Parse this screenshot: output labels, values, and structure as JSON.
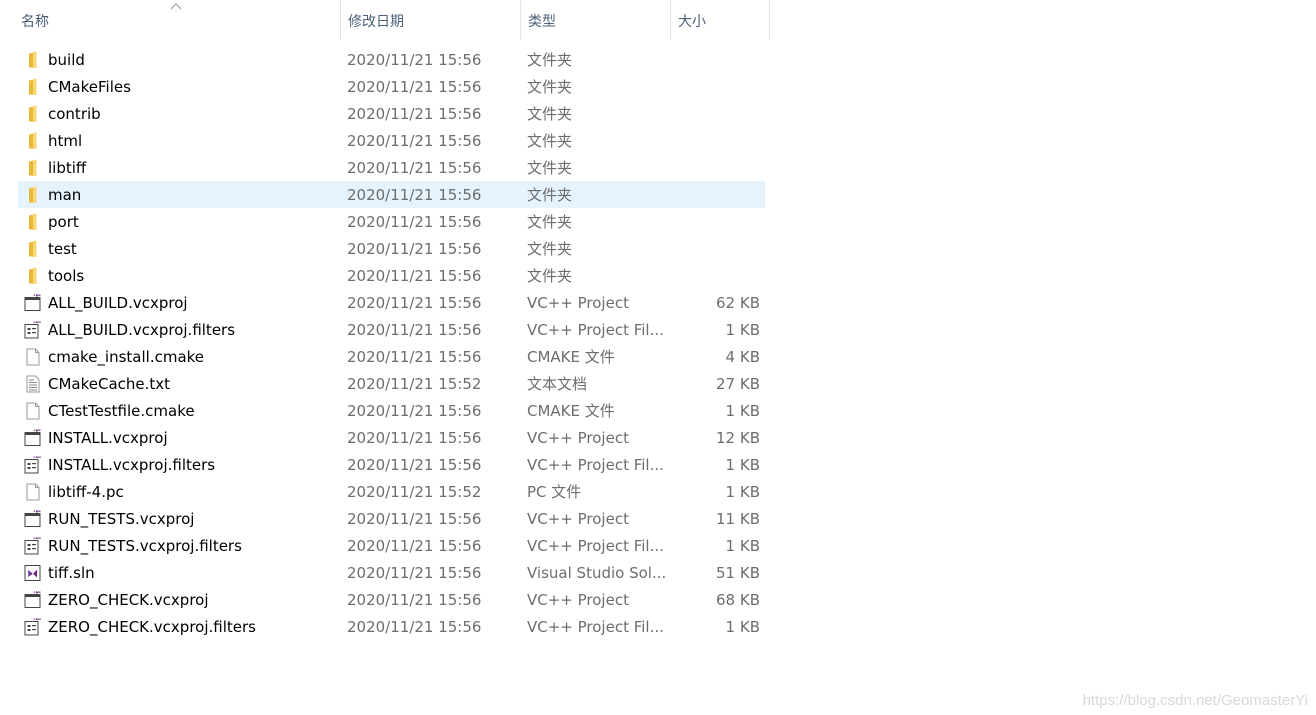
{
  "columns": {
    "name": "名称",
    "date": "修改日期",
    "type": "类型",
    "size": "大小"
  },
  "selected_index": 5,
  "files": [
    {
      "name": "build",
      "date": "2020/11/21 15:56",
      "type": "文件夹",
      "size": "",
      "icon": "folder-icon"
    },
    {
      "name": "CMakeFiles",
      "date": "2020/11/21 15:56",
      "type": "文件夹",
      "size": "",
      "icon": "folder-icon"
    },
    {
      "name": "contrib",
      "date": "2020/11/21 15:56",
      "type": "文件夹",
      "size": "",
      "icon": "folder-icon"
    },
    {
      "name": "html",
      "date": "2020/11/21 15:56",
      "type": "文件夹",
      "size": "",
      "icon": "folder-icon"
    },
    {
      "name": "libtiff",
      "date": "2020/11/21 15:56",
      "type": "文件夹",
      "size": "",
      "icon": "folder-icon"
    },
    {
      "name": "man",
      "date": "2020/11/21 15:56",
      "type": "文件夹",
      "size": "",
      "icon": "folder-icon"
    },
    {
      "name": "port",
      "date": "2020/11/21 15:56",
      "type": "文件夹",
      "size": "",
      "icon": "folder-icon"
    },
    {
      "name": "test",
      "date": "2020/11/21 15:56",
      "type": "文件夹",
      "size": "",
      "icon": "folder-icon"
    },
    {
      "name": "tools",
      "date": "2020/11/21 15:56",
      "type": "文件夹",
      "size": "",
      "icon": "folder-icon"
    },
    {
      "name": "ALL_BUILD.vcxproj",
      "date": "2020/11/21 15:56",
      "type": "VC++ Project",
      "size": "62 KB",
      "icon": "vcxproj-icon"
    },
    {
      "name": "ALL_BUILD.vcxproj.filters",
      "date": "2020/11/21 15:56",
      "type": "VC++ Project Fil...",
      "size": "1 KB",
      "icon": "vcxproj-filters-icon"
    },
    {
      "name": "cmake_install.cmake",
      "date": "2020/11/21 15:56",
      "type": "CMAKE 文件",
      "size": "4 KB",
      "icon": "file-icon"
    },
    {
      "name": "CMakeCache.txt",
      "date": "2020/11/21 15:52",
      "type": "文本文档",
      "size": "27 KB",
      "icon": "text-file-icon"
    },
    {
      "name": "CTestTestfile.cmake",
      "date": "2020/11/21 15:56",
      "type": "CMAKE 文件",
      "size": "1 KB",
      "icon": "file-icon"
    },
    {
      "name": "INSTALL.vcxproj",
      "date": "2020/11/21 15:56",
      "type": "VC++ Project",
      "size": "12 KB",
      "icon": "vcxproj-icon"
    },
    {
      "name": "INSTALL.vcxproj.filters",
      "date": "2020/11/21 15:56",
      "type": "VC++ Project Fil...",
      "size": "1 KB",
      "icon": "vcxproj-filters-icon"
    },
    {
      "name": "libtiff-4.pc",
      "date": "2020/11/21 15:52",
      "type": "PC 文件",
      "size": "1 KB",
      "icon": "file-icon"
    },
    {
      "name": "RUN_TESTS.vcxproj",
      "date": "2020/11/21 15:56",
      "type": "VC++ Project",
      "size": "11 KB",
      "icon": "vcxproj-icon"
    },
    {
      "name": "RUN_TESTS.vcxproj.filters",
      "date": "2020/11/21 15:56",
      "type": "VC++ Project Fil...",
      "size": "1 KB",
      "icon": "vcxproj-filters-icon"
    },
    {
      "name": "tiff.sln",
      "date": "2020/11/21 15:56",
      "type": "Visual Studio Sol...",
      "size": "51 KB",
      "icon": "sln-icon"
    },
    {
      "name": "ZERO_CHECK.vcxproj",
      "date": "2020/11/21 15:56",
      "type": "VC++ Project",
      "size": "68 KB",
      "icon": "vcxproj-icon"
    },
    {
      "name": "ZERO_CHECK.vcxproj.filters",
      "date": "2020/11/21 15:56",
      "type": "VC++ Project Fil...",
      "size": "1 KB",
      "icon": "vcxproj-filters-icon"
    }
  ],
  "watermark": "https://blog.csdn.net/GeomasterYi",
  "colors": {
    "header_text": "#4c607a",
    "secondary_text": "#6d6d6d",
    "selection": "#e5f3ff",
    "folder": "#f8d775",
    "vs_purple": "#68217a"
  }
}
